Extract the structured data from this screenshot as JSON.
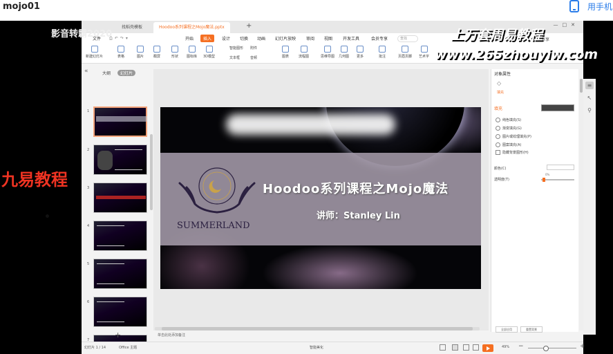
{
  "page": {
    "title": "mojo01",
    "phone_link": "用手机"
  },
  "overlays": {
    "player_label": "影音转霸2020",
    "left_watermark": "九易教程",
    "right_title": "上万套周易教程",
    "right_url": "www.265zhouyiw.com"
  },
  "app": {
    "tabs": [
      {
        "label": "找稻壳模板"
      },
      {
        "label": "Hoodoo系列课程之Mojo魔法.pptx"
      }
    ],
    "menus": [
      {
        "label": "文件"
      },
      {
        "label": "开始"
      },
      {
        "label": "插入"
      },
      {
        "label": "设计"
      },
      {
        "label": "切换"
      },
      {
        "label": "动画"
      },
      {
        "label": "幻灯片放映"
      },
      {
        "label": "审阅"
      },
      {
        "label": "视图"
      },
      {
        "label": "开发工具"
      },
      {
        "label": "会员专享"
      }
    ],
    "search_label": "查找",
    "share_label": "分享",
    "ribbon": [
      {
        "label": "新建幻灯片"
      },
      {
        "label": "表格"
      },
      {
        "label": "图片"
      },
      {
        "label": "截屏"
      },
      {
        "label": "形状"
      },
      {
        "label": "图标库"
      },
      {
        "label": "3D模型"
      },
      {
        "label": "图表"
      },
      {
        "label": "流程图"
      },
      {
        "label": "思维导图"
      },
      {
        "label": "几何图"
      },
      {
        "label": "更多"
      },
      {
        "label": "批注"
      },
      {
        "label": "页眉页脚"
      },
      {
        "label": "艺术字"
      }
    ],
    "ribbon_side": [
      {
        "label": "智能图形"
      },
      {
        "label": "文本框"
      },
      {
        "label": "附件"
      },
      {
        "label": "音频"
      }
    ],
    "left_pane": {
      "outline_tab": "大纲",
      "slides_tab": "幻灯片",
      "slide_numbers": [
        "1",
        "2",
        "3",
        "4",
        "5",
        "6",
        "7"
      ],
      "add_symbol": "+"
    },
    "slide": {
      "title": "Hoodoo系列课程之Mojo魔法",
      "subtitle": "讲师：Stanley Lin",
      "logo_text": "SUMMERLAND"
    },
    "notes_label": "单击此处添加备注",
    "props": {
      "title": "对象属性",
      "tab": "填充",
      "section": "填充",
      "options": [
        {
          "label": "纯色填充(S)"
        },
        {
          "label": "渐变填充(G)"
        },
        {
          "label": "图片或纹理填充(P)"
        },
        {
          "label": "图案填充(A)"
        }
      ],
      "checkbox_label": "隐藏背景图形(H)",
      "color_label": "颜色(C)",
      "transparency_label": "透明度(T)",
      "transparency_value": "0%",
      "buttons": [
        {
          "label": "全部应用"
        },
        {
          "label": "重置背景"
        }
      ]
    },
    "status": {
      "slide_count": "幻灯片 1 / 14",
      "theme": "Office 主题",
      "smart_beautify": "智能美化",
      "zoom": "49%"
    },
    "colors": {
      "accent": "#f56f22",
      "fill_swatch": "#444444"
    }
  }
}
